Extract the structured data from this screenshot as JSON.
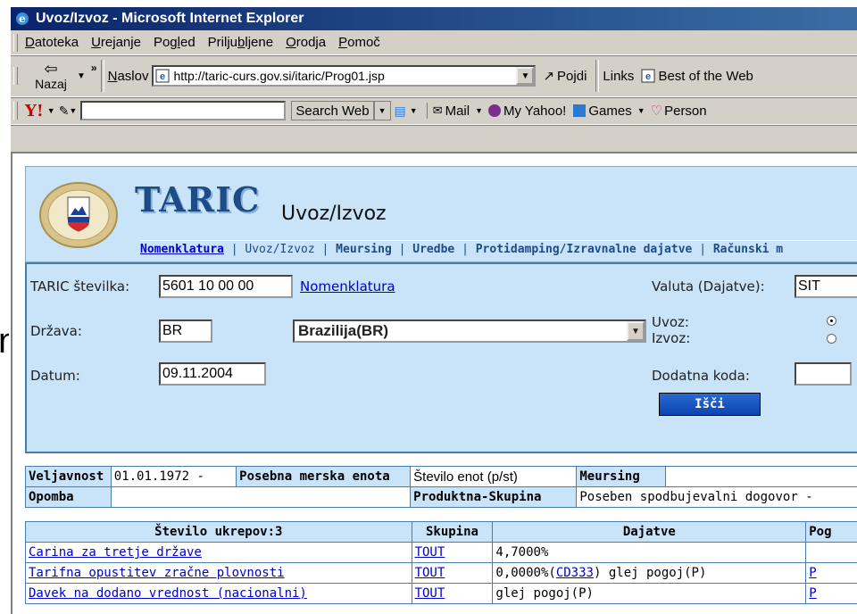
{
  "window": {
    "title": "Uvoz/Izvoz - Microsoft Internet Explorer"
  },
  "menu": [
    "Datoteka",
    "Urejanje",
    "Pogled",
    "Priljubljene",
    "Orodja",
    "Pomoč"
  ],
  "toolbar": {
    "back_label": "Nazaj",
    "address_label": "Naslov",
    "url": "http://taric-curs.gov.si/itaric/Prog01.jsp",
    "go_label": "Pojdi",
    "links_label": "Links",
    "link1": "Best of the Web"
  },
  "yahoo_bar": {
    "logo": "Y!",
    "search_label": "Search Web",
    "mail": "Mail",
    "myyahoo": "My Yahoo!",
    "games": "Games",
    "personals": "Person"
  },
  "side_fragment": "n,",
  "site": {
    "title": "TARIC",
    "subtitle": "Uvoz/Izvoz",
    "nav": {
      "nomenklatura": "Nomenklatura",
      "sep1": " | ",
      "uvoz": "Uvoz/Izvoz",
      "sep2": " | ",
      "meursing": "Meursing",
      "sep3": " | ",
      "uredbe": "Uredbe",
      "sep4": " | ",
      "protidamping": "Protidamping/Izravnalne dajatve",
      "sep5": " | ",
      "racunski": "Računski m"
    }
  },
  "form": {
    "taric_label": "TARIC številka:",
    "taric_value": "5601 10 00 00",
    "nomenklatura_link": "Nomenklatura",
    "valuta_label": "Valuta (Dajatve):",
    "valuta_value": "SIT",
    "drzava_label": "Država:",
    "drzava_code": "BR",
    "drzava_name": "Brazilija(BR)",
    "uvoz_label": "Uvoz:",
    "izvoz_label": "Izvoz:",
    "datum_label": "Datum:",
    "datum_value": "09.11.2004",
    "dodatna_label": "Dodatna koda:",
    "dodatna_value": "",
    "search_label": "Išči"
  },
  "info": {
    "veljavnost_label": "Veljavnost",
    "veljavnost_value": "01.01.1972 -",
    "posebna_label": "Posebna merska enota",
    "posebna_value": "Število enot (p/st)",
    "meursing_label": "Meursing",
    "opomba_label": "Opomba",
    "opomba_value": "",
    "produktna_label": "Produktna-Skupina",
    "produktna_value": "Poseben spodbujevalni dogovor -"
  },
  "results": {
    "headers": [
      "Število ukrepov:3",
      "Skupina",
      "Dajatve",
      "Pog"
    ],
    "rows": [
      {
        "name": "Carina za tretje države",
        "group": "TOUT",
        "duty_a": "4,7000%",
        "duty_link": "",
        "duty_b": "",
        "cond": ""
      },
      {
        "name": "Tarifna opustitev zračne plovnosti",
        "group": "TOUT",
        "duty_a": "0,0000%(",
        "duty_link": "CD333",
        "duty_b": ") glej pogoj(P)",
        "cond": "P"
      },
      {
        "name": "Davek na dodano vrednost (nacionalni)",
        "group": "TOUT",
        "duty_a": "glej pogoj(P)",
        "duty_link": "",
        "duty_b": "",
        "cond": "P"
      }
    ]
  }
}
